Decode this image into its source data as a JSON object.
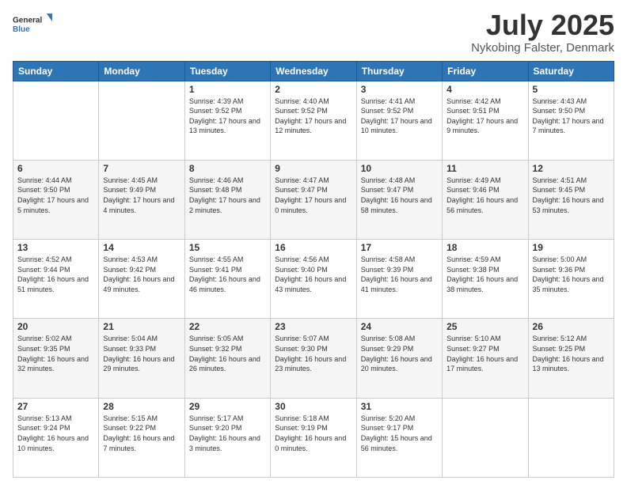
{
  "logo": {
    "text_general": "General",
    "text_blue": "Blue"
  },
  "header": {
    "title": "July 2025",
    "subtitle": "Nykobing Falster, Denmark"
  },
  "days_of_week": [
    "Sunday",
    "Monday",
    "Tuesday",
    "Wednesday",
    "Thursday",
    "Friday",
    "Saturday"
  ],
  "weeks": [
    [
      {
        "day": "",
        "info": ""
      },
      {
        "day": "",
        "info": ""
      },
      {
        "day": "1",
        "info": "Sunrise: 4:39 AM\nSunset: 9:52 PM\nDaylight: 17 hours and 13 minutes."
      },
      {
        "day": "2",
        "info": "Sunrise: 4:40 AM\nSunset: 9:52 PM\nDaylight: 17 hours and 12 minutes."
      },
      {
        "day": "3",
        "info": "Sunrise: 4:41 AM\nSunset: 9:52 PM\nDaylight: 17 hours and 10 minutes."
      },
      {
        "day": "4",
        "info": "Sunrise: 4:42 AM\nSunset: 9:51 PM\nDaylight: 17 hours and 9 minutes."
      },
      {
        "day": "5",
        "info": "Sunrise: 4:43 AM\nSunset: 9:50 PM\nDaylight: 17 hours and 7 minutes."
      }
    ],
    [
      {
        "day": "6",
        "info": "Sunrise: 4:44 AM\nSunset: 9:50 PM\nDaylight: 17 hours and 5 minutes."
      },
      {
        "day": "7",
        "info": "Sunrise: 4:45 AM\nSunset: 9:49 PM\nDaylight: 17 hours and 4 minutes."
      },
      {
        "day": "8",
        "info": "Sunrise: 4:46 AM\nSunset: 9:48 PM\nDaylight: 17 hours and 2 minutes."
      },
      {
        "day": "9",
        "info": "Sunrise: 4:47 AM\nSunset: 9:47 PM\nDaylight: 17 hours and 0 minutes."
      },
      {
        "day": "10",
        "info": "Sunrise: 4:48 AM\nSunset: 9:47 PM\nDaylight: 16 hours and 58 minutes."
      },
      {
        "day": "11",
        "info": "Sunrise: 4:49 AM\nSunset: 9:46 PM\nDaylight: 16 hours and 56 minutes."
      },
      {
        "day": "12",
        "info": "Sunrise: 4:51 AM\nSunset: 9:45 PM\nDaylight: 16 hours and 53 minutes."
      }
    ],
    [
      {
        "day": "13",
        "info": "Sunrise: 4:52 AM\nSunset: 9:44 PM\nDaylight: 16 hours and 51 minutes."
      },
      {
        "day": "14",
        "info": "Sunrise: 4:53 AM\nSunset: 9:42 PM\nDaylight: 16 hours and 49 minutes."
      },
      {
        "day": "15",
        "info": "Sunrise: 4:55 AM\nSunset: 9:41 PM\nDaylight: 16 hours and 46 minutes."
      },
      {
        "day": "16",
        "info": "Sunrise: 4:56 AM\nSunset: 9:40 PM\nDaylight: 16 hours and 43 minutes."
      },
      {
        "day": "17",
        "info": "Sunrise: 4:58 AM\nSunset: 9:39 PM\nDaylight: 16 hours and 41 minutes."
      },
      {
        "day": "18",
        "info": "Sunrise: 4:59 AM\nSunset: 9:38 PM\nDaylight: 16 hours and 38 minutes."
      },
      {
        "day": "19",
        "info": "Sunrise: 5:00 AM\nSunset: 9:36 PM\nDaylight: 16 hours and 35 minutes."
      }
    ],
    [
      {
        "day": "20",
        "info": "Sunrise: 5:02 AM\nSunset: 9:35 PM\nDaylight: 16 hours and 32 minutes."
      },
      {
        "day": "21",
        "info": "Sunrise: 5:04 AM\nSunset: 9:33 PM\nDaylight: 16 hours and 29 minutes."
      },
      {
        "day": "22",
        "info": "Sunrise: 5:05 AM\nSunset: 9:32 PM\nDaylight: 16 hours and 26 minutes."
      },
      {
        "day": "23",
        "info": "Sunrise: 5:07 AM\nSunset: 9:30 PM\nDaylight: 16 hours and 23 minutes."
      },
      {
        "day": "24",
        "info": "Sunrise: 5:08 AM\nSunset: 9:29 PM\nDaylight: 16 hours and 20 minutes."
      },
      {
        "day": "25",
        "info": "Sunrise: 5:10 AM\nSunset: 9:27 PM\nDaylight: 16 hours and 17 minutes."
      },
      {
        "day": "26",
        "info": "Sunrise: 5:12 AM\nSunset: 9:25 PM\nDaylight: 16 hours and 13 minutes."
      }
    ],
    [
      {
        "day": "27",
        "info": "Sunrise: 5:13 AM\nSunset: 9:24 PM\nDaylight: 16 hours and 10 minutes."
      },
      {
        "day": "28",
        "info": "Sunrise: 5:15 AM\nSunset: 9:22 PM\nDaylight: 16 hours and 7 minutes."
      },
      {
        "day": "29",
        "info": "Sunrise: 5:17 AM\nSunset: 9:20 PM\nDaylight: 16 hours and 3 minutes."
      },
      {
        "day": "30",
        "info": "Sunrise: 5:18 AM\nSunset: 9:19 PM\nDaylight: 16 hours and 0 minutes."
      },
      {
        "day": "31",
        "info": "Sunrise: 5:20 AM\nSunset: 9:17 PM\nDaylight: 15 hours and 56 minutes."
      },
      {
        "day": "",
        "info": ""
      },
      {
        "day": "",
        "info": ""
      }
    ]
  ]
}
